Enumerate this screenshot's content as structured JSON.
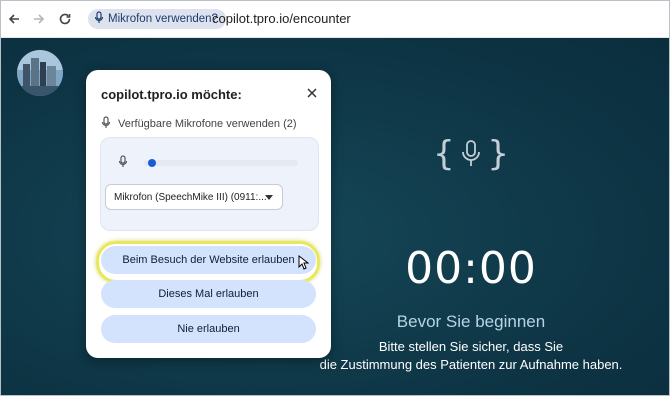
{
  "browser": {
    "chip_label": "Mikrofon verwenden?",
    "url": "copilot.tpro.io/encounter"
  },
  "dialog": {
    "title": "copilot.tpro.io möchte:",
    "permission_text": "Verfügbare Mikrofone verwenden (2)",
    "mic_level_fraction": 0.03,
    "selected_device": "Mikrofon (SpeechMike III) (0911:...",
    "allow_on_visit_label": "Beim Besuch der Website erlauben",
    "allow_once_label": "Dieses Mal erlauben",
    "never_allow_label": "Nie erlauben"
  },
  "page": {
    "timer": "00:00",
    "prepare_title": "Bevor Sie beginnen",
    "hint_line1": "Bitte stellen Sie sicher, dass Sie",
    "hint_line2": "die Zustimmung des Patienten zur Aufnahme haben."
  },
  "icons": [
    "back-icon",
    "forward-icon",
    "reload-icon",
    "microphone-icon",
    "close-icon",
    "chevron-down-icon",
    "mouse-cursor-icon"
  ],
  "colors": {
    "accent": "#1a5bd6",
    "page_bg": "#0f3a4b",
    "button_bg": "#d3e3fd",
    "highlight": "#e9e85a"
  }
}
